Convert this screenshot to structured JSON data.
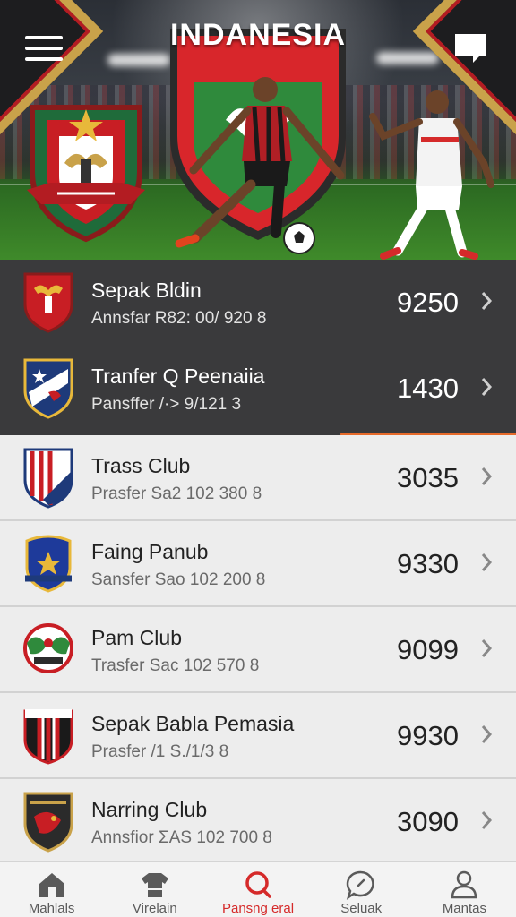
{
  "header": {
    "crest_title": "INDANESIA",
    "menu_icon": "hamburger-menu-icon",
    "chat_icon": "chat-bubble-icon"
  },
  "colors": {
    "accent": "#e66a2a",
    "active_nav": "#d52a2a",
    "dark_row": "#3a3a3c",
    "light_row": "#ededed"
  },
  "clubs": [
    {
      "name": "Sepak Bldin",
      "subtitle": "Annsfar R82: 00/ 920 8",
      "value": "9250",
      "badge_icon": "garuda-shield-badge-icon"
    },
    {
      "name": "Tranfer Q Peenaiia",
      "subtitle": "Pansffer /·> 9/121 3",
      "value": "1430",
      "badge_icon": "star-shield-badge-icon"
    },
    {
      "name": "Trass Club",
      "subtitle": "Prasfer Sa2 102 380 8",
      "value": "3035",
      "badge_icon": "striped-shield-badge-icon"
    },
    {
      "name": "Faing Panub",
      "subtitle": "Sansfer Sao 102 200 8",
      "value": "9330",
      "badge_icon": "star-crest-badge-icon"
    },
    {
      "name": "Pam Club",
      "subtitle": "Trasfer Sac 102 570 8",
      "value": "9099",
      "badge_icon": "eagle-round-badge-icon"
    },
    {
      "name": "Sepak Babla Pemasia",
      "subtitle": "Prasfer /1 S./1/3 8",
      "value": "9930",
      "badge_icon": "red-stripe-badge-icon"
    },
    {
      "name": "Narring Club",
      "subtitle": "Annsfior ƩAS 102 700 8",
      "value": "3090",
      "badge_icon": "dark-shield-badge-icon"
    }
  ],
  "nav": [
    {
      "label": "Mahlals",
      "icon": "home-icon"
    },
    {
      "label": "Virelain",
      "icon": "jersey-icon"
    },
    {
      "label": "Pansng eral",
      "icon": "search-icon",
      "active": true
    },
    {
      "label": "Seluak",
      "icon": "chat-icon"
    },
    {
      "label": "Mantas",
      "icon": "user-icon"
    }
  ]
}
